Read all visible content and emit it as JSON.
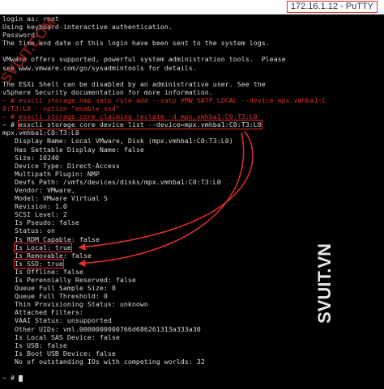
{
  "window": {
    "title": "172.16.1.12 - PuTTY"
  },
  "watermarks": {
    "top": "SVUIT.COM",
    "bottom": "SVUIT.VN"
  },
  "terminal": {
    "lines": [
      {
        "text": "login as: root",
        "style": "normal"
      },
      {
        "text": "Using keyboard-interactive authentication.",
        "style": "normal"
      },
      {
        "text": "Password:",
        "style": "normal"
      },
      {
        "text": "The time and date of this login have been sent to the system logs.",
        "style": "normal"
      },
      {
        "text": "",
        "style": "normal"
      },
      {
        "text": "VMware offers supported, powerful system administration tools.  Please",
        "style": "normal"
      },
      {
        "text": "see www.vmware.com/go/sysadmintools for details.",
        "style": "normal"
      },
      {
        "text": "",
        "style": "normal"
      },
      {
        "text": "The ESXi Shell can be disabled by an administrative user. See the",
        "style": "normal"
      },
      {
        "text": "vSphere Security documentation for more information.",
        "style": "normal"
      },
      {
        "text": "~ # esxcli storage nmp satp rule add --satp VMW_SATP_LOCAL --device mpx.vmhba1:C",
        "style": "red"
      },
      {
        "text": "0:T3:L0 --option \"enable_ssd\"",
        "style": "red"
      },
      {
        "text": "~ # esxcli storage core claiming reclaim -d mpx.vmhba1:C0:T3:L0",
        "style": "red"
      },
      {
        "text": "esxcli storage core device list --device=mpx.vmhba1:C0:T3:L0",
        "style": "cmd",
        "prompt": "~ # "
      },
      {
        "text": "mpx.vmhba1:C0:T3:L0",
        "style": "normal"
      },
      {
        "text": "   Display Name: Local VMware, Disk (mpx.vmhba1:C0:T3:L0)",
        "style": "normal"
      },
      {
        "text": "   Has Settable Display Name: false",
        "style": "normal"
      },
      {
        "text": "   Size: 10240",
        "style": "normal"
      },
      {
        "text": "   Device Type: Direct-Access",
        "style": "normal"
      },
      {
        "text": "   Multipath Plugin: NMP",
        "style": "normal"
      },
      {
        "text": "   Devfs Path: /vmfs/devices/disks/mpx.vmhba1:C0:T3:L0",
        "style": "normal"
      },
      {
        "text": "   Vendor: VMware,",
        "style": "normal"
      },
      {
        "text": "   Model: VMware Virtual S",
        "style": "normal"
      },
      {
        "text": "   Revision: 1.0",
        "style": "normal"
      },
      {
        "text": "   SCSI Level: 2",
        "style": "normal"
      },
      {
        "text": "   Is Pseudo: false",
        "style": "normal"
      },
      {
        "text": "   Status: on",
        "style": "normal"
      },
      {
        "text": "   Is RDM Capable: false",
        "style": "normal"
      },
      {
        "text": "Is Local: true",
        "style": "boxed",
        "indent": "   "
      },
      {
        "text": "   Is Removable: false",
        "style": "normal"
      },
      {
        "text": "Is SSD: true",
        "style": "boxed",
        "indent": "   "
      },
      {
        "text": "   Is Offline: false",
        "style": "normal"
      },
      {
        "text": "   Is Perennially Reserved: false",
        "style": "normal"
      },
      {
        "text": "   Queue Full Sample Size: 0",
        "style": "normal"
      },
      {
        "text": "   Queue Full Threshold: 0",
        "style": "normal"
      },
      {
        "text": "   Thin Provisioning Status: unknown",
        "style": "normal"
      },
      {
        "text": "   Attached Filters:",
        "style": "normal"
      },
      {
        "text": "   VAAI Status: unsupported",
        "style": "normal"
      },
      {
        "text": "   Other UIDs: vml.0000000000766d686261313a333a30",
        "style": "normal"
      },
      {
        "text": "   Is Local SAS Device: false",
        "style": "normal"
      },
      {
        "text": "   Is USB: false",
        "style": "normal"
      },
      {
        "text": "   Is Boot USB Device: false",
        "style": "normal"
      },
      {
        "text": "   No of outstanding IOs with competing worlds: 32",
        "style": "normal"
      },
      {
        "text": "",
        "style": "normal"
      },
      {
        "text": "~ # ",
        "style": "cursor"
      }
    ]
  },
  "colors": {
    "terminal_bg": "#000000",
    "terminal_fg": "#d8d8d8",
    "highlight": "#e0312a"
  }
}
